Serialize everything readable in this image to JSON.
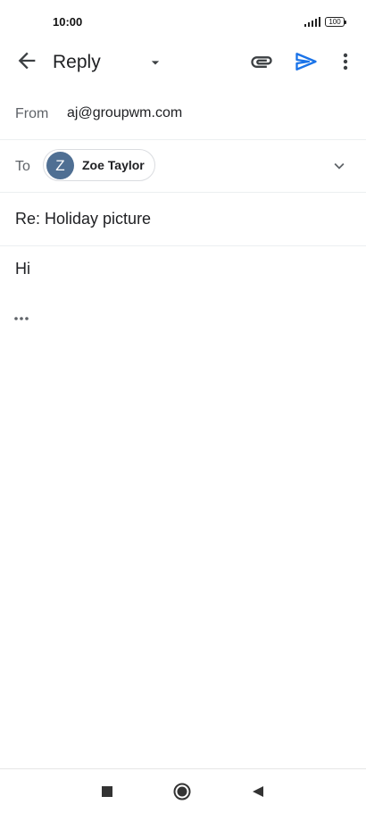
{
  "status": {
    "time": "10:00",
    "battery": "100"
  },
  "header": {
    "title": "Reply"
  },
  "compose": {
    "from_label": "From",
    "from_value": "aj@groupwm.com",
    "to_label": "To",
    "recipient": {
      "initial": "Z",
      "name": "Zoe Taylor"
    },
    "subject": "Re: Holiday picture",
    "body": "Hi"
  },
  "colors": {
    "accent": "#1a73e8",
    "avatar": "#4f6f93"
  },
  "icons": [
    "back-arrow-icon",
    "dropdown-caret-icon",
    "attach-icon",
    "send-icon",
    "more-vert-icon",
    "chevron-down-icon",
    "ellipsis-icon",
    "stop-square-icon",
    "home-circle-icon",
    "nav-back-icon"
  ]
}
